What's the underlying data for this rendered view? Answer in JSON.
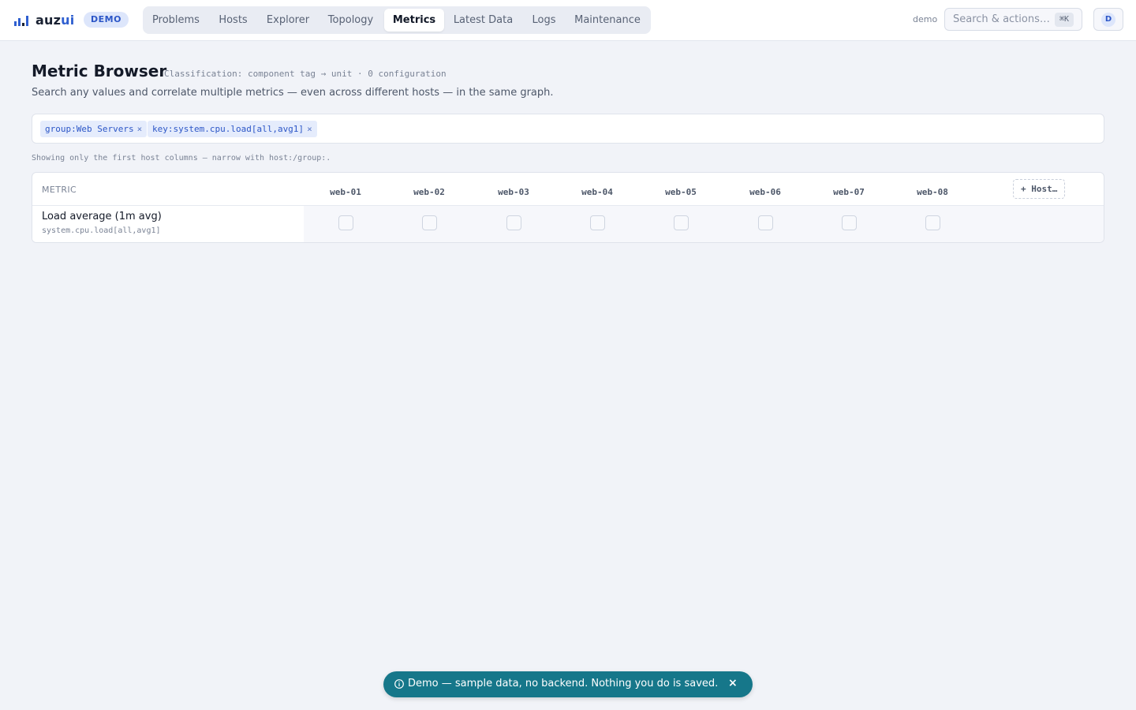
{
  "app": {
    "name_prefix": "auz",
    "name_accent": "ui",
    "badge": "DEMO"
  },
  "nav": {
    "items": [
      "Problems",
      "Hosts",
      "Explorer",
      "Topology",
      "Metrics",
      "Latest Data",
      "Logs",
      "Maintenance"
    ],
    "active": "Metrics"
  },
  "header": {
    "user_label": "demo",
    "search_placeholder": "Search & actions…",
    "search_shortcut": "⌘K",
    "avatar_initial": "D"
  },
  "page": {
    "title": "Metric Browser",
    "classification": "Classification: component tag → unit · 0 configuration",
    "subtitle": "Search any values and correlate multiple metrics — even across different hosts — in the same graph."
  },
  "filters": {
    "chips": [
      {
        "label": "group:Web Servers",
        "remove": "×"
      },
      {
        "label": "key:system.cpu.load[all,avg1]",
        "remove": "×"
      }
    ]
  },
  "hint": "Showing only the first host columns — narrow with host:/group:.",
  "table": {
    "metric_header": "METRIC",
    "hosts": [
      "web-01",
      "web-02",
      "web-03",
      "web-04",
      "web-05",
      "web-06",
      "web-07",
      "web-08"
    ],
    "add_host_label": "+ Host…",
    "rows": [
      {
        "name": "Load average (1m avg)",
        "key": "system.cpu.load[all,avg1]",
        "selected": [
          false,
          false,
          false,
          false,
          false,
          false,
          false,
          false
        ]
      }
    ]
  },
  "toast": {
    "message": "Demo — sample data, no backend. Nothing you do is saved.",
    "close": "×"
  },
  "colors": {
    "accent": "#2f5fd0",
    "toast_bg": "#16778a",
    "background": "#f1f3f8"
  }
}
